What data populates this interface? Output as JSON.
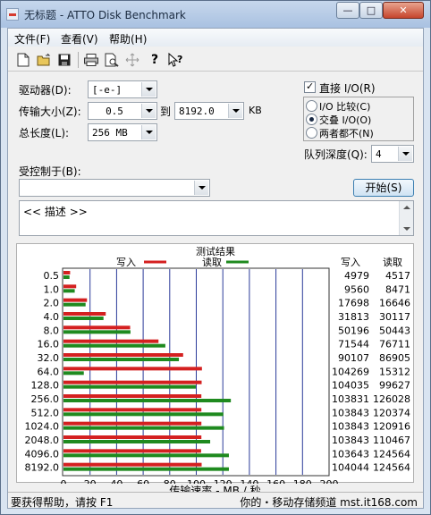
{
  "window": {
    "title": "无标题 - ATTO Disk Benchmark",
    "minimize": "—",
    "maximize": "□",
    "close": "✕"
  },
  "menu": {
    "file": "文件(F)",
    "view": "查看(V)",
    "help": "帮助(H)"
  },
  "toolbar": {
    "icons": [
      "new-document-icon",
      "open-folder-icon",
      "save-icon",
      "print-icon",
      "print-preview-icon",
      "move-icon",
      "help-icon",
      "context-help-icon"
    ]
  },
  "form": {
    "drive_label": "驱动器(D):",
    "drive_value": "[-e-]",
    "transfer_label": "传输大小(Z):",
    "transfer_from": "0.5",
    "transfer_to_label": "到",
    "transfer_to": "8192.0",
    "transfer_unit": "KB",
    "total_length_label": "总长度(L):",
    "total_length_value": "256 MB",
    "direct_io_label": "直接 I/O(R)",
    "io_compare_label": "I/O 比较(C)",
    "overlapped_io_label": "交叠 I/O(O)",
    "neither_label": "两者都不(N)",
    "queue_depth_label": "队列深度(Q):",
    "queue_depth_value": "4",
    "controlled_by_label": "受控制于(B):",
    "controlled_by_value": "",
    "start_button": "开始(S)",
    "description": "<< 描述 >>"
  },
  "results": {
    "title": "测试结果",
    "legend_write": "写入",
    "legend_read": "读取",
    "col_write": "写入",
    "col_read": "读取",
    "write_color": "#d42020",
    "read_color": "#1f8a1f"
  },
  "chart_data": {
    "type": "bar",
    "orientation": "horizontal",
    "title": "测试结果",
    "xlabel": "传输速率 - MB / 秒",
    "xlim": [
      0,
      200
    ],
    "xticks": [
      0,
      20,
      40,
      60,
      80,
      100,
      120,
      140,
      160,
      180,
      200
    ],
    "categories": [
      "0.5",
      "1.0",
      "2.0",
      "4.0",
      "8.0",
      "16.0",
      "32.0",
      "64.0",
      "128.0",
      "256.0",
      "512.0",
      "1024.0",
      "2048.0",
      "4096.0",
      "8192.0"
    ],
    "series": [
      {
        "name": "写入",
        "values": [
          4979,
          9560,
          17698,
          31813,
          50196,
          71544,
          90107,
          104269,
          104035,
          103831,
          103843,
          103843,
          103843,
          103643,
          104044
        ]
      },
      {
        "name": "读取",
        "values": [
          4517,
          8471,
          16646,
          30117,
          50443,
          76711,
          86905,
          15312,
          99627,
          126028,
          120374,
          120916,
          110467,
          124564,
          124564
        ]
      }
    ],
    "grid": true
  },
  "status": {
    "help_text": "要获得帮助，请按 F1",
    "right_text": "你的・移动存储频道  mst.it168.com"
  }
}
